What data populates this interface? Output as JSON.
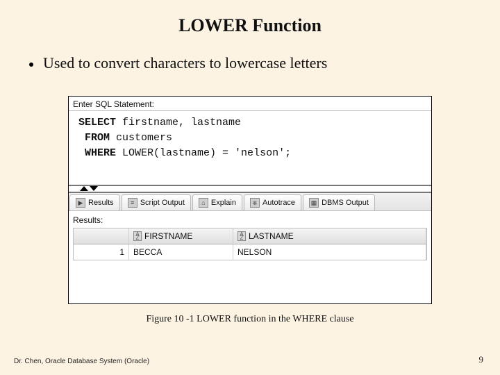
{
  "title": "LOWER Function",
  "bullet": "Used to convert characters to lowercase letters",
  "sql_panel": {
    "label": "Enter SQL Statement:",
    "kw_select": "SELECT",
    "sel_cols": " firstname, lastname",
    "kw_from": "FROM",
    "from_tbl": " customers",
    "kw_where": "WHERE",
    "where_expr": " LOWER(lastname) = 'nelson';"
  },
  "tabs": {
    "t0": "Results",
    "t1": "Script Output",
    "t2": "Explain",
    "t3": "Autotrace",
    "t4": "DBMS Output"
  },
  "results": {
    "label": "Results:",
    "headers": {
      "c0": "FIRSTNAME",
      "c1": "LASTNAME"
    },
    "row1": {
      "n": "1",
      "c0": "BECCA",
      "c1": "NELSON"
    }
  },
  "caption": "Figure 10 -1   LOWER function in the WHERE clause",
  "footer_left": "Dr. Chen, Oracle Database System (Oracle)",
  "page_number": "9"
}
